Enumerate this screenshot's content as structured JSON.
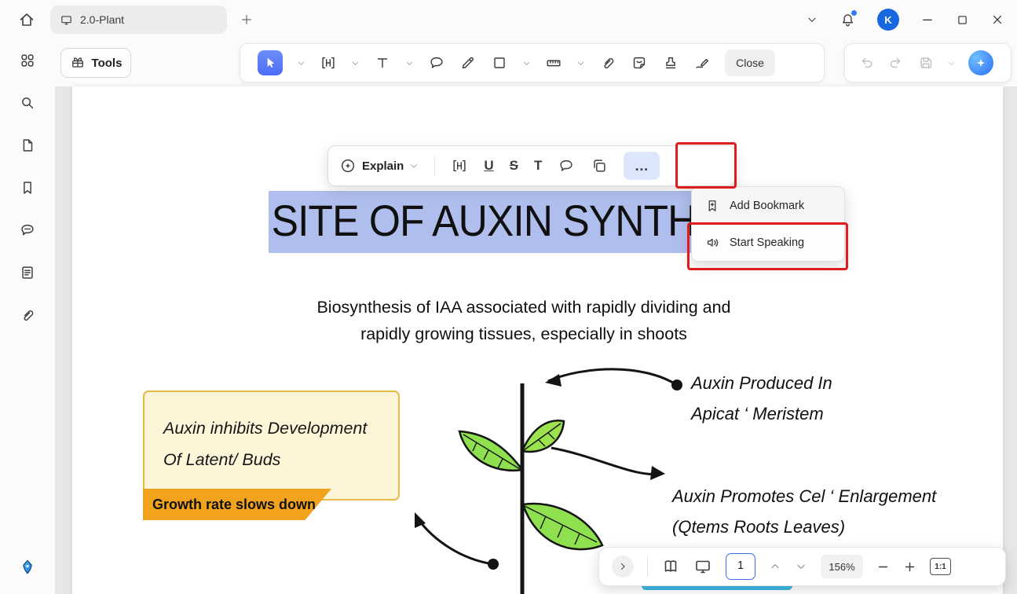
{
  "titlebar": {
    "tab_title": "2.0-Plant",
    "avatar_initial": "K"
  },
  "toolbar": {
    "tools_label": "Tools",
    "close_label": "Close"
  },
  "glyphs": {
    "underline": "U",
    "strike": "S",
    "text": "T",
    "more": "…"
  },
  "explain_bar": {
    "label": "Explain"
  },
  "context_menu": {
    "add_bookmark": "Add Bookmark",
    "start_speaking": "Start Speaking"
  },
  "document": {
    "heading": "SITE OF AUXIN SYNTH",
    "subtitle_line1": "Biosynthesis of IAA associated with rapidly dividing and",
    "subtitle_line2": "rapidly growing tissues, especially in shoots",
    "callout_line1": "Auxin inhibits Development",
    "callout_line2": "Of Latent/ Buds",
    "callout_tag": "Growth rate slows down",
    "note_top_line1": "Auxin Produced In",
    "note_top_line2": "Apicat ‘ Meristem",
    "note_bottom_line1": "Auxin Promotes Cel ‘ Enlargement",
    "note_bottom_line2": "(Qtems Roots Leaves)"
  },
  "status_bar": {
    "page_number": "1",
    "zoom_level": "156%",
    "actual_size": "1:1"
  },
  "colors": {
    "accent_blue": "#4a6cf7",
    "annotation_red": "#e11b1b",
    "selection_highlight": "#afbeec",
    "callout_bg": "#fcf5d8",
    "callout_border": "#e3bb45",
    "tag_orange": "#f2a31d",
    "leaf_green": "#8ee04e",
    "scrollbar_blue": "#3fb9e9"
  }
}
